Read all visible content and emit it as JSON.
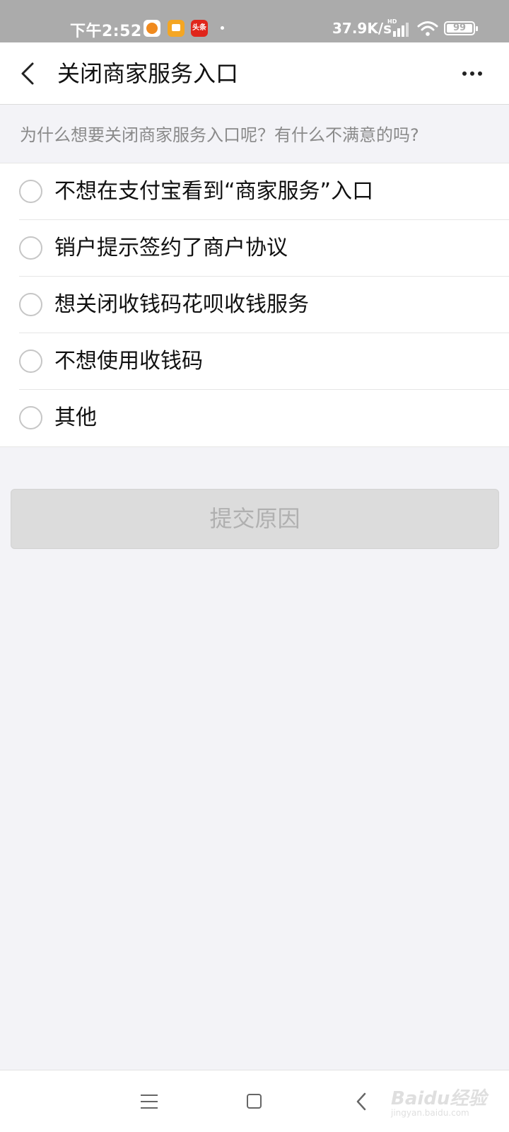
{
  "status_bar": {
    "time": "下午2:52",
    "app_badge_3": "头条",
    "net_speed": "37.9K/s",
    "signal_label": "HD",
    "battery": "99"
  },
  "nav": {
    "title": "关闭商家服务入口"
  },
  "question": "为什么想要关闭商家服务入口呢？有什么不满意的吗?",
  "options": [
    {
      "label": "不想在支付宝看到“商家服务”入口"
    },
    {
      "label": "销户提示签约了商户协议"
    },
    {
      "label": "想关闭收钱码花呗收钱服务"
    },
    {
      "label": "不想使用收钱码"
    },
    {
      "label": "其他"
    }
  ],
  "submit_label": "提交原因",
  "watermark": {
    "brand": "Baidu经验",
    "url": "jingyan.baidu.com"
  },
  "colors": {
    "status_bar_bg": "#ababab",
    "page_bg": "#f3f3f7",
    "submit_disabled_bg": "#dcdcdc",
    "submit_disabled_text": "#b0b0b0"
  }
}
